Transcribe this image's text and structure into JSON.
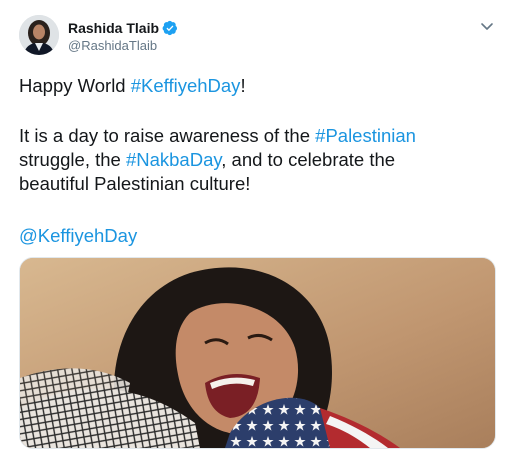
{
  "author": {
    "name": "Rashida Tlaib",
    "handle": "@RashidaTlaib",
    "verified": true
  },
  "tweet": {
    "line1": {
      "pre": "Happy World ",
      "hashtag": "#KeffiyehDay",
      "post": "!"
    },
    "line2": {
      "pre": "It is a day to raise awareness of the ",
      "hashtag": "#Palestinian"
    },
    "line3": {
      "pre": "struggle, the ",
      "hashtag": "#NakbaDay",
      "post": ", and to celebrate the"
    },
    "line4": "beautiful Palestinian culture!",
    "mention": "@KeffiyehDay"
  },
  "colors": {
    "link": "#1b95e0",
    "verified": "#1da1f2",
    "muted": "#657786"
  },
  "icons": {
    "verified": "verified-badge-icon",
    "menu": "chevron-down-icon"
  }
}
